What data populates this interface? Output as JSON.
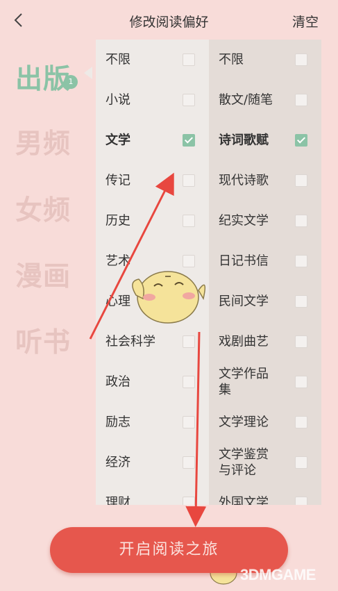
{
  "header": {
    "back_icon": "chevron-left-icon",
    "title": "修改阅读偏好",
    "clear_label": "清空"
  },
  "categories": [
    {
      "label": "出版",
      "active": true,
      "badge": "1"
    },
    {
      "label": "男频",
      "active": false
    },
    {
      "label": "女频",
      "active": false
    },
    {
      "label": "漫画",
      "active": false
    },
    {
      "label": "听书",
      "active": false
    }
  ],
  "column1": [
    {
      "label": "不限",
      "checked": false
    },
    {
      "label": "小说",
      "checked": false
    },
    {
      "label": "文学",
      "checked": true
    },
    {
      "label": "传记",
      "checked": false
    },
    {
      "label": "历史",
      "checked": false
    },
    {
      "label": "艺术",
      "checked": false
    },
    {
      "label": "心理",
      "checked": false
    },
    {
      "label": "社会科学",
      "checked": false
    },
    {
      "label": "政治",
      "checked": false
    },
    {
      "label": "励志",
      "checked": false
    },
    {
      "label": "经济",
      "checked": false
    },
    {
      "label": "理财",
      "checked": false
    }
  ],
  "column2": [
    {
      "label": "不限",
      "checked": false
    },
    {
      "label": "散文/随笔",
      "checked": false
    },
    {
      "label": "诗词歌赋",
      "checked": true
    },
    {
      "label": "现代诗歌",
      "checked": false
    },
    {
      "label": "纪实文学",
      "checked": false
    },
    {
      "label": "日记书信",
      "checked": false
    },
    {
      "label": "民间文学",
      "checked": false
    },
    {
      "label": "戏剧曲艺",
      "checked": false
    },
    {
      "label": "文学作品\n集",
      "checked": false
    },
    {
      "label": "文学理论",
      "checked": false
    },
    {
      "label": "文学鉴赏\n与评论",
      "checked": false
    },
    {
      "label": "外国文学",
      "checked": false
    }
  ],
  "start_button": {
    "label": "开启阅读之旅"
  },
  "watermark": {
    "text": "3DMGAME"
  },
  "colors": {
    "background": "#f8dcd9",
    "accent_green": "#8bc3a6",
    "button_red": "#e6574d",
    "arrow_red": "#e8473f"
  }
}
